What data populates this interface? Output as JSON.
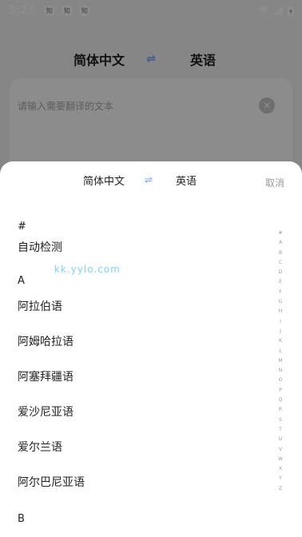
{
  "status_bar": {
    "time": "3:26",
    "notif_icon_text": "知"
  },
  "background": {
    "source_lang": "简体中文",
    "swap_symbol": "⇌",
    "target_lang": "英语",
    "input_placeholder": "请输入需要翻译的文本",
    "clear_symbol": "✕"
  },
  "sheet": {
    "source_lang": "简体中文",
    "swap_symbol": "⇌",
    "target_lang": "英语",
    "cancel_label": "取消",
    "watermark": "kk.yylo.com",
    "sections": [
      {
        "header": "#",
        "items": [
          "自动检测"
        ]
      },
      {
        "header": "A",
        "items": [
          "阿拉伯语",
          "阿姆哈拉语",
          "阿塞拜疆语",
          "爱沙尼亚语",
          "爱尔兰语",
          "阿尔巴尼亚语"
        ]
      },
      {
        "header": "B",
        "items": []
      }
    ],
    "alpha_index": [
      "#",
      "A",
      "B",
      "C",
      "D",
      "E",
      "F",
      "G",
      "H",
      "I",
      "J",
      "K",
      "L",
      "M",
      "N",
      "O",
      "P",
      "Q",
      "R",
      "S",
      "T",
      "U",
      "V",
      "W",
      "X",
      "Y",
      "Z"
    ]
  }
}
